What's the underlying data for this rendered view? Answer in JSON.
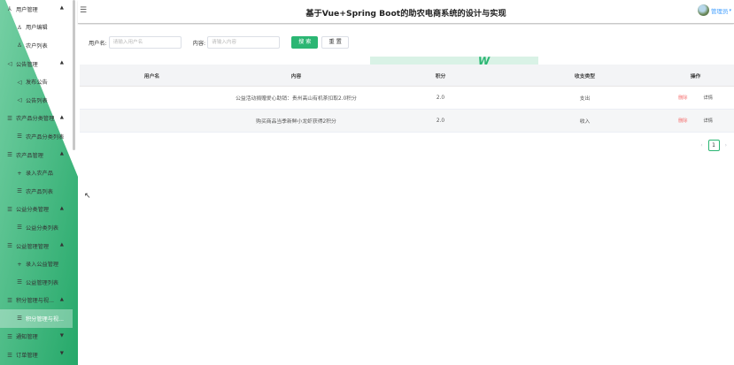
{
  "app": {
    "title": "基于Vue+Spring Boot的助农电商系统的设计与实现"
  },
  "header": {
    "menu_icon": "hamburger-icon",
    "user_label": "管理员"
  },
  "sidebar": {
    "items": [
      {
        "label": "用户管理",
        "icon": "user-group-icon",
        "type": "group",
        "chevron": "▲"
      },
      {
        "label": "用户编辑",
        "icon": "user-icon",
        "type": "sub"
      },
      {
        "label": "农户列表",
        "icon": "user-icon",
        "type": "sub"
      },
      {
        "label": "公告管理",
        "icon": "speaker-icon",
        "type": "group",
        "chevron": "▲"
      },
      {
        "label": "发布公告",
        "icon": "speaker-icon",
        "type": "sub"
      },
      {
        "label": "公告列表",
        "icon": "speaker-icon",
        "type": "sub"
      },
      {
        "label": "农产品分类管理",
        "icon": "list-icon",
        "type": "group",
        "chevron": "▲"
      },
      {
        "label": "农产品分类列表",
        "icon": "list-icon",
        "type": "sub"
      },
      {
        "label": "农产品管理",
        "icon": "list-icon",
        "type": "group",
        "chevron": "▲"
      },
      {
        "label": "录入农产品",
        "icon": "plus-icon",
        "type": "sub"
      },
      {
        "label": "农产品列表",
        "icon": "list-icon",
        "type": "sub"
      },
      {
        "label": "公益分类管理",
        "icon": "list-icon",
        "type": "group",
        "chevron": "▲"
      },
      {
        "label": "公益分类列表",
        "icon": "list-icon",
        "type": "sub"
      },
      {
        "label": "公益管理管理",
        "icon": "list-icon",
        "type": "group",
        "chevron": "▲"
      },
      {
        "label": "录入公益管理",
        "icon": "plus-icon",
        "type": "sub"
      },
      {
        "label": "公益管理列表",
        "icon": "list-icon",
        "type": "sub"
      },
      {
        "label": "积分管理与视...",
        "icon": "list-icon",
        "type": "group",
        "chevron": "▲"
      },
      {
        "label": "积分管理与视...",
        "icon": "list-icon",
        "type": "sub",
        "active": true
      },
      {
        "label": "通知管理",
        "icon": "list-icon",
        "type": "group",
        "chevron": "▼"
      },
      {
        "label": "订单管理",
        "icon": "list-icon",
        "type": "group",
        "chevron": "▼"
      }
    ]
  },
  "search": {
    "username_label": "用户名:",
    "username_placeholder": "请输入用户名",
    "content_label": "内容:",
    "content_placeholder": "请输入内容",
    "search_button": "搜 索",
    "reset_button": "重 置"
  },
  "table": {
    "columns": [
      "用户名",
      "内容",
      "积分",
      "收支类型",
      "操作"
    ],
    "rows": [
      {
        "username": "",
        "content": "公益活动捐赠爱心助销：贵州高山有机茶扣取2.0积分",
        "points": "2.0",
        "type": "支出",
        "delete": "删除",
        "detail": "详情"
      },
      {
        "username": "",
        "content": "购买商品当季新鲜小龙虾获得2积分",
        "points": "2.0",
        "type": "收入",
        "delete": "删除",
        "detail": "详情"
      }
    ]
  },
  "pagination": {
    "prev": "‹",
    "current": "1",
    "next": "›"
  },
  "colors": {
    "accent": "#2bb673",
    "danger": "#f56c6c",
    "link": "#409eff"
  }
}
